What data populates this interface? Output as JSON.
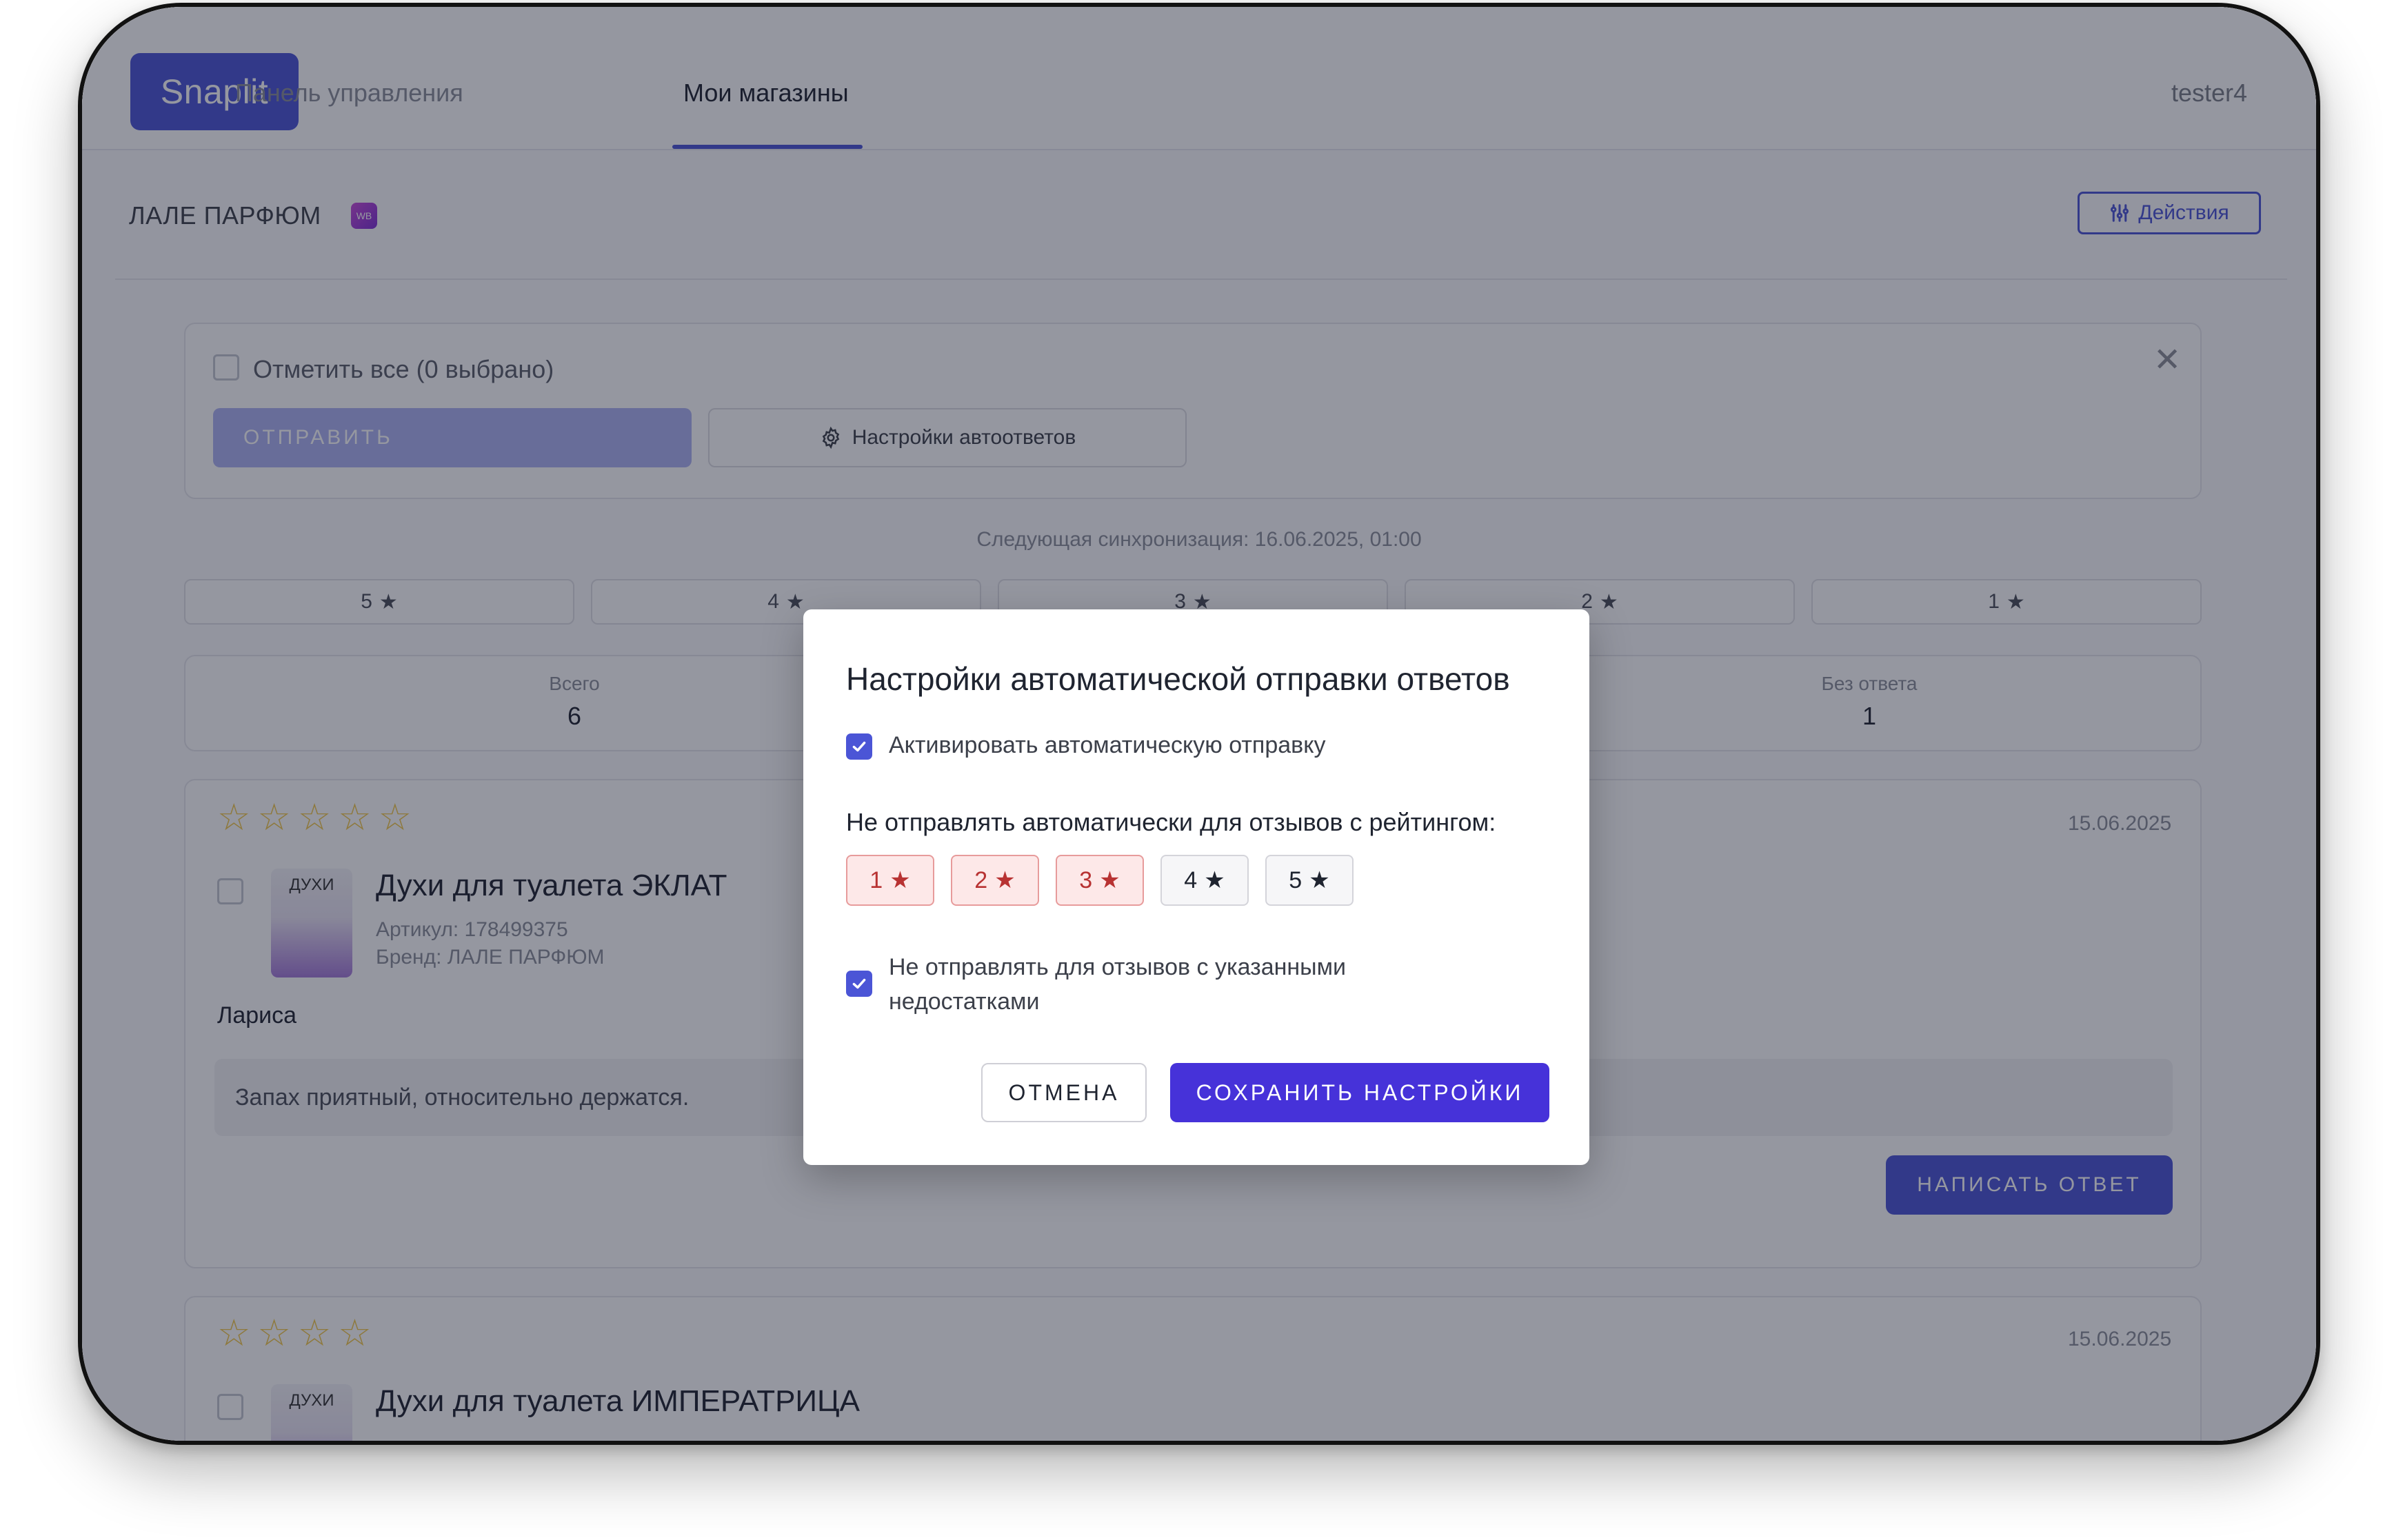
{
  "nav": {
    "logo": "Snaplit",
    "links": [
      {
        "label": "Панель управления",
        "active": false
      },
      {
        "label": "Мои магазины",
        "active": true
      }
    ],
    "user": "tester4"
  },
  "store": {
    "name": "ЛАЛЕ ПАРФЮМ",
    "marketplace_badge": "WB",
    "actions_label": "Действия"
  },
  "selection": {
    "select_all_label": "Отметить все (0 выбрано)",
    "send_label": "ОТПРАВИТЬ",
    "auto_settings_label": "Настройки автоответов"
  },
  "sync": {
    "text": "Следующая синхронизация: 16.06.2025, 01:00"
  },
  "rating_filters": [
    {
      "label": "5"
    },
    {
      "label": "4"
    },
    {
      "label": "3"
    },
    {
      "label": "2"
    },
    {
      "label": "1"
    }
  ],
  "stats": {
    "total_label": "Всего",
    "total_value": "6",
    "no_reply_label": "Без ответа",
    "no_reply_value": "1"
  },
  "reviews": [
    {
      "stars": 5,
      "date": "15.06.2025",
      "thumb_text": "ДУХИ",
      "product": "Духи для туалета ЭКЛАТ",
      "sku": "Артикул: 178499375",
      "brand": "Бренд: ЛАЛЕ ПАРФЮМ",
      "author": "Лариса",
      "text": "Запах приятный, относительно держатся.",
      "reply_label": "НАПИСАТЬ ОТВЕТ"
    },
    {
      "stars": 4,
      "date": "15.06.2025",
      "thumb_text": "ДУХИ",
      "product": "Духи для туалета ИМПЕРАТРИЦА"
    }
  ],
  "modal": {
    "title": "Настройки автоматической отправки ответов",
    "activate_label": "Активировать автоматическую отправку",
    "activate_checked": true,
    "exclude_label": "Не отправлять автоматически для отзывов с рейтингом:",
    "ratings": [
      {
        "label": "1",
        "selected": true
      },
      {
        "label": "2",
        "selected": true
      },
      {
        "label": "3",
        "selected": true
      },
      {
        "label": "4",
        "selected": false
      },
      {
        "label": "5",
        "selected": false
      }
    ],
    "defects_label": "Не отправлять для отзывов с указанными недостатками",
    "defects_checked": true,
    "cancel_label": "ОТМЕНА",
    "save_label": "СОХРАНИТЬ НАСТРОЙКИ"
  },
  "colors": {
    "accent": "#4b55d6",
    "save_button": "#4632d9",
    "selected_rating_bg": "#fde8e8",
    "star": "#f2c94c"
  }
}
